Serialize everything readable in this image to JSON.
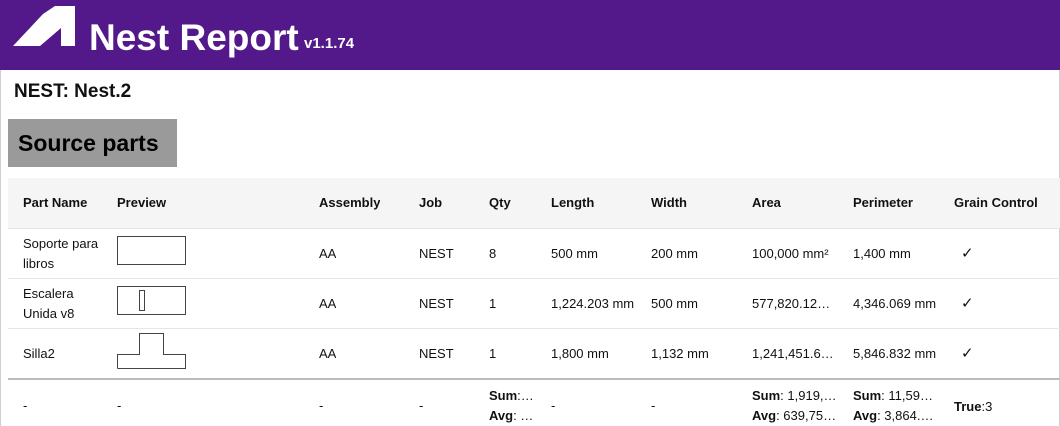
{
  "header": {
    "title": "Nest Report",
    "version": "v1.1.74",
    "background_color": "#53198a",
    "logo_icon": "autodesk-logo-icon"
  },
  "nest_title": "NEST: Nest.2",
  "section_title": "Source parts",
  "table": {
    "columns": [
      "Part Name",
      "Preview",
      "Assembly",
      "Job",
      "Qty",
      "Length",
      "Width",
      "Area",
      "Perimeter",
      "Grain Control"
    ],
    "rows": [
      {
        "name": "Soporte para libros",
        "preview": "rectangle-preview",
        "assembly": "AA",
        "job": "NEST",
        "qty": "8",
        "length": "500 mm",
        "width": "200 mm",
        "area": "100,000 mm²",
        "perimeter": "1,400 mm",
        "grain": "✓"
      },
      {
        "name": "Escalera Unida v8",
        "preview": "ladder-preview",
        "assembly": "AA",
        "job": "NEST",
        "qty": "1",
        "length": "1,224.203 mm",
        "width": "500 mm",
        "area": "577,820.12…",
        "perimeter": "4,346.069 mm",
        "grain": "✓"
      },
      {
        "name": "Silla2",
        "preview": "t-shape-preview",
        "assembly": "AA",
        "job": "NEST",
        "qty": "1",
        "length": "1,800 mm",
        "width": "1,132 mm",
        "area": "1,241,451.6…",
        "perimeter": "5,846.832 mm",
        "grain": "✓"
      }
    ],
    "summary": {
      "name": "-",
      "preview": "-",
      "assembly": "-",
      "job": "-",
      "qty_sum_label": "Sum",
      "qty_sum": ":…",
      "qty_avg_label": "Avg",
      "qty_avg": ": …",
      "length": "-",
      "width": "-",
      "area_sum_label": "Sum",
      "area_sum": ": 1,919,…",
      "area_avg_label": "Avg",
      "area_avg": ": 639,75…",
      "perimeter_sum_label": "Sum",
      "perimeter_sum": ": 11,59…",
      "perimeter_avg_label": "Avg",
      "perimeter_avg": ": 3,864.…",
      "grain_label": "True",
      "grain_value": ":3"
    }
  }
}
